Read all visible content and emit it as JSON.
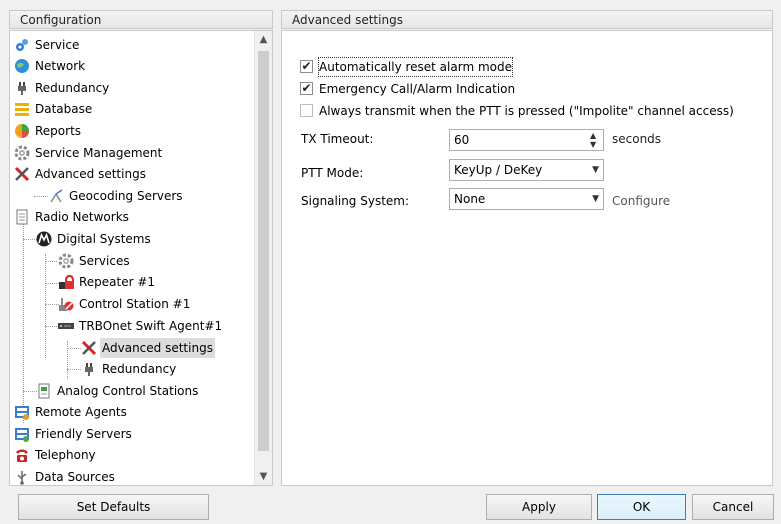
{
  "left_panel": {
    "header": "Configuration"
  },
  "right_panel": {
    "header": "Advanced settings"
  },
  "tree": [
    {
      "label": "Service",
      "icon": "service-gear-icon"
    },
    {
      "label": "Network",
      "icon": "globe-icon"
    },
    {
      "label": "Redundancy",
      "icon": "plug-icon"
    },
    {
      "label": "Database",
      "icon": "database-icon"
    },
    {
      "label": "Reports",
      "icon": "reports-icon"
    },
    {
      "label": "Service Management",
      "icon": "gear-icon"
    },
    {
      "label": "Advanced settings",
      "icon": "tools-icon"
    },
    {
      "label": "Geocoding Servers",
      "icon": "geocoding-icon"
    },
    {
      "label": "Radio Networks",
      "icon": "document-icon"
    },
    {
      "label": "Digital Systems",
      "icon": "motorola-icon"
    },
    {
      "label": "Services",
      "icon": "gear-icon"
    },
    {
      "label": "Repeater #1",
      "icon": "repeater-icon"
    },
    {
      "label": "Control Station #1",
      "icon": "control-station-icon"
    },
    {
      "label": "TRBOnet Swift Agent#1",
      "icon": "agent-device-icon"
    },
    {
      "label": "Advanced settings",
      "icon": "tools-icon",
      "selected": true
    },
    {
      "label": "Redundancy",
      "icon": "plug-icon"
    },
    {
      "label": "Analog Control Stations",
      "icon": "analog-station-icon"
    },
    {
      "label": "Remote Agents",
      "icon": "remote-agents-icon"
    },
    {
      "label": "Friendly Servers",
      "icon": "friendly-servers-icon"
    },
    {
      "label": "Telephony",
      "icon": "telephone-icon"
    },
    {
      "label": "Data Sources",
      "icon": "usb-icon"
    }
  ],
  "settings": {
    "checkboxes": [
      {
        "label": "Automatically reset alarm mode",
        "checked": true
      },
      {
        "label": "Emergency Call/Alarm Indication",
        "checked": true
      },
      {
        "label": "Always transmit when the PTT is pressed (\"Impolite\" channel access)",
        "checked": false
      }
    ],
    "tx_timeout": {
      "label": "TX Timeout:",
      "value": "60",
      "unit": "seconds"
    },
    "ptt_mode": {
      "label": "PTT Mode:",
      "value": "KeyUp / DeKey"
    },
    "signaling": {
      "label": "Signaling System:",
      "value": "None",
      "link": "Configure"
    }
  },
  "buttons": {
    "set_defaults": "Set Defaults",
    "apply": "Apply",
    "ok": "OK",
    "cancel": "Cancel"
  },
  "colors": {
    "selection": "#dcdcdc",
    "default_button_border": "#3c7fb1"
  }
}
